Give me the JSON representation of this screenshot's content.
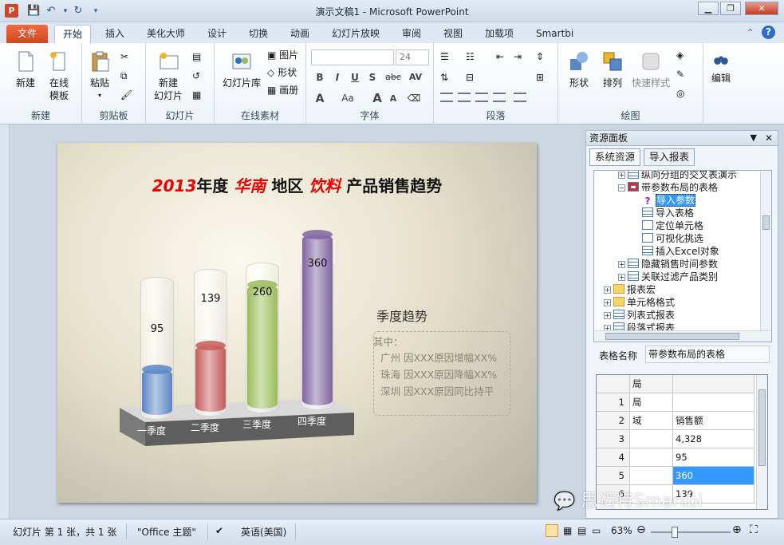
{
  "window": {
    "title": "演示文稿1 - Microsoft PowerPoint",
    "app_badge": "P"
  },
  "tabs": [
    "文件",
    "开始",
    "插入",
    "美化大师",
    "设计",
    "切换",
    "动画",
    "幻灯片放映",
    "审阅",
    "视图",
    "加载项",
    "Smartbi"
  ],
  "ribbon": {
    "new": {
      "new": "新建",
      "online1": "在线",
      "online2": "模板",
      "group": "新建"
    },
    "clipboard": {
      "paste": "粘贴",
      "group": "剪贴板"
    },
    "slides": {
      "new1": "新建",
      "new2": "幻灯片",
      "library": "幻灯片库",
      "group": "幻灯片"
    },
    "online": {
      "picture": "图片",
      "shape": "形状",
      "canvas": "画册",
      "group": "在线素材"
    },
    "font": {
      "size": "24",
      "group": "字体",
      "b": "B",
      "i": "I",
      "u": "U",
      "s": "S",
      "abc": "abc",
      "av": "AV",
      "a": "A",
      "aa": "Aa",
      "grow": "A",
      "shrink": "A"
    },
    "paragraph": {
      "group": "段落"
    },
    "drawing": {
      "shape": "形状",
      "arrange": "排列",
      "quick": "快速样式",
      "group": "绘图"
    },
    "editing": {
      "edit": "编辑"
    }
  },
  "slide": {
    "title_year": "2013",
    "title_mid1": "年度 ",
    "title_region": "华南",
    "title_mid2": " 地区 ",
    "title_product": "饮料",
    "title_end": " 产品销售趋势",
    "season_title": "季度趋势",
    "note_head": "其中：",
    "notes": [
      "广州 因XXX原因增幅XX%",
      "珠海 因XXX原因降幅XX%",
      "深圳 因XXX原因同比持平"
    ]
  },
  "chart_data": {
    "type": "bar",
    "categories": [
      "一季度",
      "二季度",
      "三季度",
      "四季度"
    ],
    "values": [
      95,
      139,
      260,
      360
    ],
    "colors": [
      "#5b86c4",
      "#c55a5a",
      "#9bbb59",
      "#8064a2"
    ],
    "title": "",
    "ylim": [
      0,
      420
    ]
  },
  "panel": {
    "title": "资源面板",
    "tabs": [
      "系统资源",
      "导入报表"
    ],
    "tree": [
      {
        "label": "纵向分组的交叉表演示",
        "level": 2,
        "expander": "+",
        "icon": "table"
      },
      {
        "label": "带参数布局的表格",
        "level": 2,
        "expander": "-",
        "icon": "table-check"
      },
      {
        "label": "导入参数",
        "level": 3,
        "expander": "",
        "icon": "question",
        "selected": true
      },
      {
        "label": "导入表格",
        "level": 3,
        "expander": "",
        "icon": "table"
      },
      {
        "label": "定位单元格",
        "level": 3,
        "expander": "",
        "icon": "doc"
      },
      {
        "label": "可视化挑选",
        "level": 3,
        "expander": "",
        "icon": "doc"
      },
      {
        "label": "插入Excel对象",
        "level": 3,
        "expander": "",
        "icon": "table"
      },
      {
        "label": "隐藏销售时间参数",
        "level": 2,
        "expander": "+",
        "icon": "table"
      },
      {
        "label": "关联过滤产品类别",
        "level": 2,
        "expander": "+",
        "icon": "table"
      },
      {
        "label": "报表宏",
        "level": 1,
        "expander": "+",
        "icon": "folder"
      },
      {
        "label": "单元格格式",
        "level": 1,
        "expander": "+",
        "icon": "folder"
      },
      {
        "label": "列表式报表",
        "level": 1,
        "expander": "+",
        "icon": "table"
      },
      {
        "label": "段落式报表",
        "level": 1,
        "expander": "+",
        "icon": "table"
      }
    ],
    "table_name_label": "表格名称",
    "table_name_value": "带参数布局的表格",
    "grid": {
      "header": [
        "",
        "局",
        ""
      ],
      "rows": [
        {
          "num": "1",
          "a": "局",
          "b": ""
        },
        {
          "num": "2",
          "a": "域",
          "b": "销售额"
        },
        {
          "num": "3",
          "a": "",
          "b": "4,328"
        },
        {
          "num": "4",
          "a": "",
          "b": "95"
        },
        {
          "num": "5",
          "a": "",
          "b": "360",
          "selected": true
        },
        {
          "num": "6",
          "a": "",
          "b": "139"
        }
      ]
    }
  },
  "status": {
    "slide_info": "幻灯片 第 1 张，共 1 张",
    "theme": "\"Office 主题\"",
    "language": "英语(美国)",
    "zoom": "63%"
  },
  "watermark": "思迈特Smartbi"
}
